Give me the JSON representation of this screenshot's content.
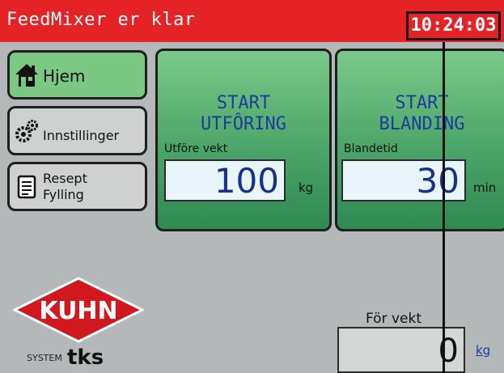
{
  "header": {
    "status_text": "FeedMixer er klar",
    "clock": "10:24:03"
  },
  "nav": {
    "home_label": "Hjem",
    "settings_label": "Innstillinger",
    "recipe_label_line1": "Resept",
    "recipe_label_line2": "Fylling"
  },
  "actions": {
    "unload": {
      "title_line1": "START",
      "title_line2": "UTFÔRING",
      "field_label": "Utföre vekt",
      "value": "100",
      "unit": "kg"
    },
    "mix": {
      "title_line1": "START",
      "title_line2": "BLANDING",
      "field_label": "Blandetid",
      "value": "30",
      "unit": "min"
    }
  },
  "weight": {
    "label": "För vekt",
    "value": "0",
    "unit": "kg"
  },
  "logo": {
    "brand": "KUHN",
    "system": "SYSTEM",
    "tks": "tks"
  },
  "colors": {
    "title_bar": "#e52226",
    "button_green": "#4fa86a",
    "value_text": "#17318f"
  }
}
